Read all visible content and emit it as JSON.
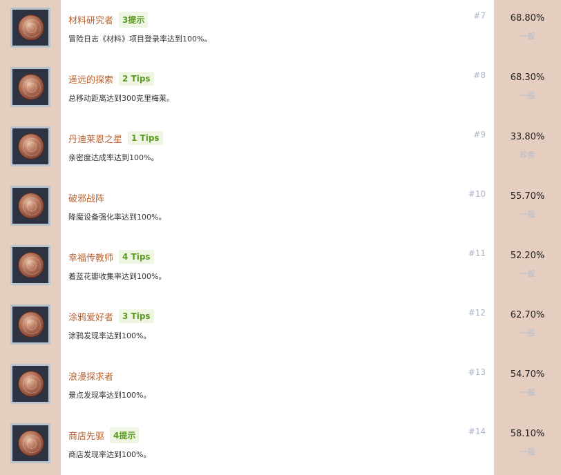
{
  "achievements": [
    {
      "icon": "bronze-medal-icon",
      "title": "材料研究者",
      "tip": "3提示",
      "desc": "冒险日志《材料》项目登录率达到100%。",
      "num": "#7",
      "pct": "68.80%",
      "rarity": "一般"
    },
    {
      "icon": "bronze-medal-icon",
      "title": "遥远的探索",
      "tip": "2 Tips",
      "desc": "总移动距离达到300克里梅莱。",
      "num": "#8",
      "pct": "68.30%",
      "rarity": "一般"
    },
    {
      "icon": "bronze-medal-icon",
      "title": "丹迪莱恩之星",
      "tip": "1 Tips",
      "desc": "亲密度达成率达到100%。",
      "num": "#9",
      "pct": "33.80%",
      "rarity": "珍贵"
    },
    {
      "icon": "bronze-medal-icon",
      "title": "破邪战阵",
      "tip": "",
      "desc": "降魔设备强化率达到100%。",
      "num": "#10",
      "pct": "55.70%",
      "rarity": "一般"
    },
    {
      "icon": "bronze-medal-icon",
      "title": "幸福传教师",
      "tip": "4 Tips",
      "desc": "着蓝花瓣收集率达到100%。",
      "num": "#11",
      "pct": "52.20%",
      "rarity": "一般"
    },
    {
      "icon": "bronze-medal-icon",
      "title": "涂鸦爱好者",
      "tip": "3 Tips",
      "desc": "涂鸦发现率达到100%。",
      "num": "#12",
      "pct": "62.70%",
      "rarity": "一般"
    },
    {
      "icon": "bronze-medal-icon",
      "title": "浪漫探求者",
      "tip": "",
      "desc": "景点发现率达到100%。",
      "num": "#13",
      "pct": "54.70%",
      "rarity": "一般"
    },
    {
      "icon": "bronze-medal-icon",
      "title": "商店先驱",
      "tip": "4提示",
      "desc": "商店发现率达到100%。",
      "num": "#14",
      "pct": "58.10%",
      "rarity": "一般"
    }
  ],
  "colors": {
    "side": "#e5cdbf",
    "title": "#b8612f",
    "tip_bg": "#eef6e3",
    "tip_fg": "#5a9b22",
    "muted": "#a9b4c8"
  }
}
